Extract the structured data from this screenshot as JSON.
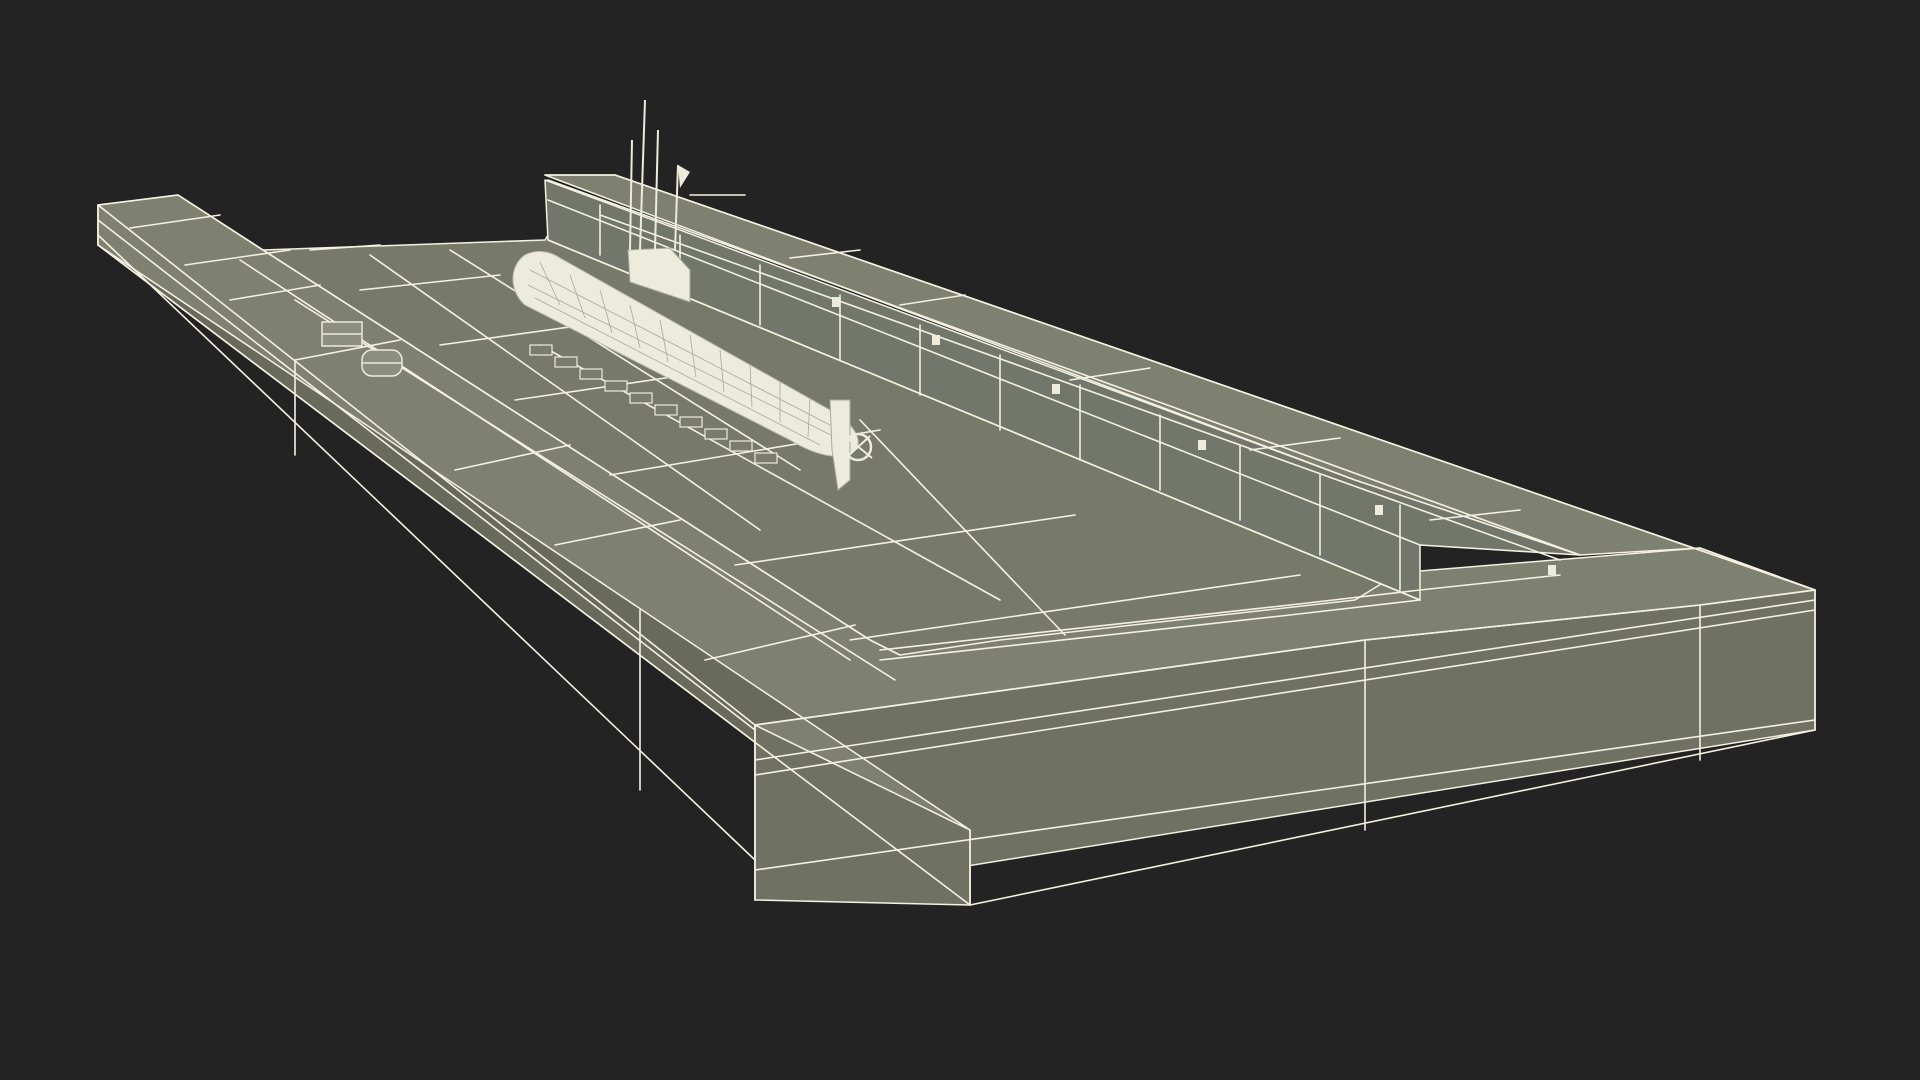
{
  "colors": {
    "background": "#232323",
    "top_surface": "#7f8170",
    "floor_surface": "#777a69",
    "front_side": "#6f7262",
    "left_side": "#686b5c",
    "inner_wall": "#73766a",
    "wireframe": "#f3f1e2",
    "submarine": "#ecebdc"
  },
  "scene": {
    "subject": "floating-dry-dock-with-submarine",
    "render_style": "wireframe-over-shaded"
  }
}
